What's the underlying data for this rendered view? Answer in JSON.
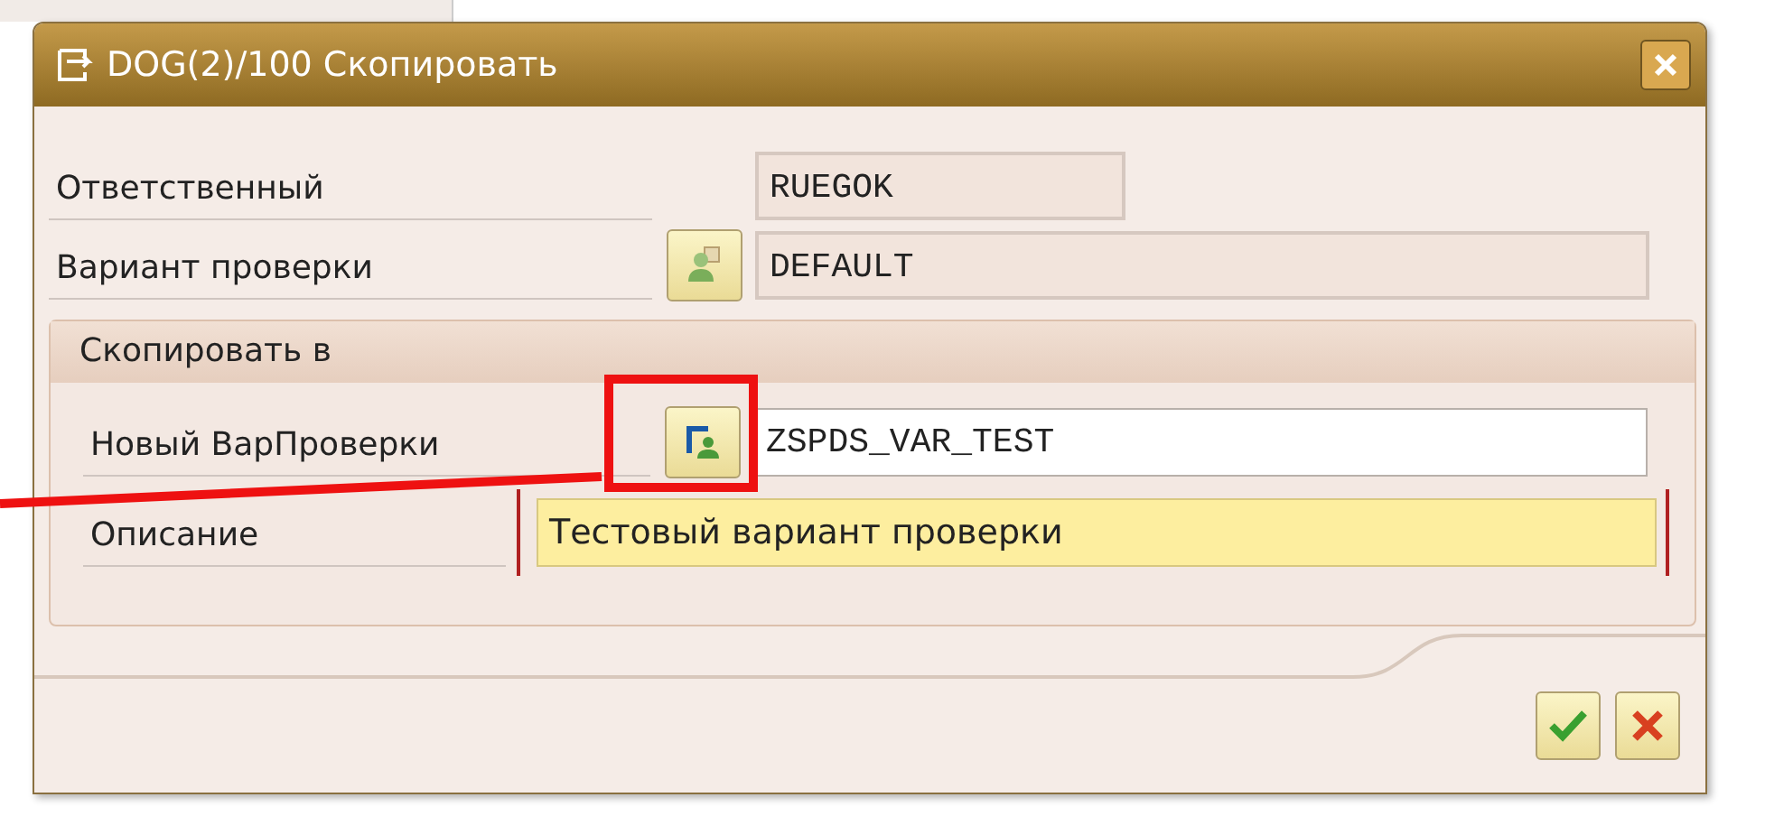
{
  "window": {
    "title": "DOG(2)/100 Скопировать"
  },
  "fields": [
    {
      "label": "Ответственный",
      "value": "RUEGOK",
      "kind": "display",
      "has_button": false
    },
    {
      "label": "Вариант проверки",
      "value": "DEFAULT",
      "kind": "display",
      "has_button": true
    }
  ],
  "group": {
    "title": "Скопировать в",
    "fields": [
      {
        "label": "Новый ВарПроверки",
        "value": "ZSPDS_VAR_TEST",
        "kind": "input",
        "has_button": true
      },
      {
        "label": "Описание",
        "value": "Тестовый вариант проверки",
        "kind": "required",
        "has_button": false
      }
    ]
  },
  "annotation": {
    "frame": true,
    "line": true
  }
}
